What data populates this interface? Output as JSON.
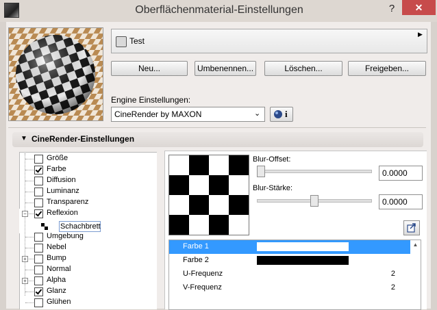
{
  "window": {
    "title": "Oberflächenmaterial-Einstellungen",
    "help": "?",
    "close": "✕"
  },
  "material": {
    "name": "Test"
  },
  "buttons": {
    "new": "Neu...",
    "rename": "Umbenennen...",
    "delete": "Löschen...",
    "share": "Freigeben..."
  },
  "engine": {
    "label": "Engine Einstellungen:",
    "selected": "CineRender by MAXON",
    "info_icon": "i"
  },
  "section": {
    "title": "CineRender-Einstellungen"
  },
  "tree": {
    "items": [
      {
        "label": "Größe",
        "checked": false,
        "expander": false
      },
      {
        "label": "Farbe",
        "checked": true,
        "expander": false
      },
      {
        "label": "Diffusion",
        "checked": false,
        "expander": false
      },
      {
        "label": "Luminanz",
        "checked": false,
        "expander": false
      },
      {
        "label": "Transparenz",
        "checked": false,
        "expander": false
      },
      {
        "label": "Reflexion",
        "checked": true,
        "expander": true
      },
      {
        "label": "Umgebung",
        "checked": false,
        "expander": false
      },
      {
        "label": "Nebel",
        "checked": false,
        "expander": false
      },
      {
        "label": "Bump",
        "checked": false,
        "expander": true
      },
      {
        "label": "Normal",
        "checked": false,
        "expander": false
      },
      {
        "label": "Alpha",
        "checked": false,
        "expander": true
      },
      {
        "label": "Glanz",
        "checked": true,
        "expander": false
      },
      {
        "label": "Glühen",
        "checked": false,
        "expander": false
      }
    ],
    "sub_item": "Schachbrett"
  },
  "blur": {
    "offset_label": "Blur-Offset:",
    "offset_value": "0.0000",
    "offset_fraction": 0.0,
    "strength_label": "Blur-Stärke:",
    "strength_value": "0.0000",
    "strength_fraction": 0.5
  },
  "params": [
    {
      "name": "Farbe 1",
      "color": "#ffffff",
      "selected": true
    },
    {
      "name": "Farbe 2",
      "color": "#000000",
      "selected": false
    },
    {
      "name": "U-Frequenz",
      "value": "2"
    },
    {
      "name": "V-Frequenz",
      "value": "2"
    }
  ],
  "colors": {
    "selection": "#3399ff",
    "close_button": "#c74b4b"
  }
}
